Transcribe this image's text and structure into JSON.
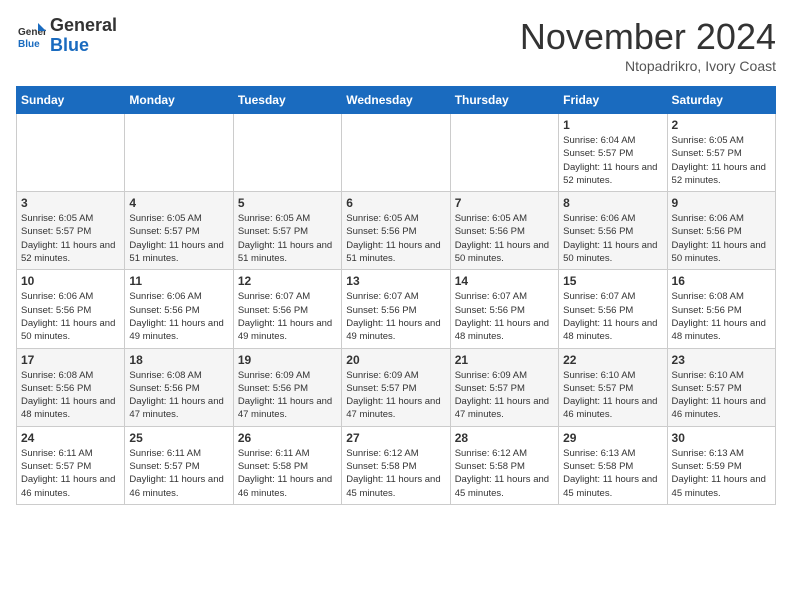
{
  "header": {
    "logo_general": "General",
    "logo_blue": "Blue",
    "month_title": "November 2024",
    "location": "Ntopadrikro, Ivory Coast"
  },
  "days_of_week": [
    "Sunday",
    "Monday",
    "Tuesday",
    "Wednesday",
    "Thursday",
    "Friday",
    "Saturday"
  ],
  "weeks": [
    [
      {
        "day": "",
        "info": ""
      },
      {
        "day": "",
        "info": ""
      },
      {
        "day": "",
        "info": ""
      },
      {
        "day": "",
        "info": ""
      },
      {
        "day": "",
        "info": ""
      },
      {
        "day": "1",
        "info": "Sunrise: 6:04 AM\nSunset: 5:57 PM\nDaylight: 11 hours and 52 minutes."
      },
      {
        "day": "2",
        "info": "Sunrise: 6:05 AM\nSunset: 5:57 PM\nDaylight: 11 hours and 52 minutes."
      }
    ],
    [
      {
        "day": "3",
        "info": "Sunrise: 6:05 AM\nSunset: 5:57 PM\nDaylight: 11 hours and 52 minutes."
      },
      {
        "day": "4",
        "info": "Sunrise: 6:05 AM\nSunset: 5:57 PM\nDaylight: 11 hours and 51 minutes."
      },
      {
        "day": "5",
        "info": "Sunrise: 6:05 AM\nSunset: 5:57 PM\nDaylight: 11 hours and 51 minutes."
      },
      {
        "day": "6",
        "info": "Sunrise: 6:05 AM\nSunset: 5:56 PM\nDaylight: 11 hours and 51 minutes."
      },
      {
        "day": "7",
        "info": "Sunrise: 6:05 AM\nSunset: 5:56 PM\nDaylight: 11 hours and 50 minutes."
      },
      {
        "day": "8",
        "info": "Sunrise: 6:06 AM\nSunset: 5:56 PM\nDaylight: 11 hours and 50 minutes."
      },
      {
        "day": "9",
        "info": "Sunrise: 6:06 AM\nSunset: 5:56 PM\nDaylight: 11 hours and 50 minutes."
      }
    ],
    [
      {
        "day": "10",
        "info": "Sunrise: 6:06 AM\nSunset: 5:56 PM\nDaylight: 11 hours and 50 minutes."
      },
      {
        "day": "11",
        "info": "Sunrise: 6:06 AM\nSunset: 5:56 PM\nDaylight: 11 hours and 49 minutes."
      },
      {
        "day": "12",
        "info": "Sunrise: 6:07 AM\nSunset: 5:56 PM\nDaylight: 11 hours and 49 minutes."
      },
      {
        "day": "13",
        "info": "Sunrise: 6:07 AM\nSunset: 5:56 PM\nDaylight: 11 hours and 49 minutes."
      },
      {
        "day": "14",
        "info": "Sunrise: 6:07 AM\nSunset: 5:56 PM\nDaylight: 11 hours and 48 minutes."
      },
      {
        "day": "15",
        "info": "Sunrise: 6:07 AM\nSunset: 5:56 PM\nDaylight: 11 hours and 48 minutes."
      },
      {
        "day": "16",
        "info": "Sunrise: 6:08 AM\nSunset: 5:56 PM\nDaylight: 11 hours and 48 minutes."
      }
    ],
    [
      {
        "day": "17",
        "info": "Sunrise: 6:08 AM\nSunset: 5:56 PM\nDaylight: 11 hours and 48 minutes."
      },
      {
        "day": "18",
        "info": "Sunrise: 6:08 AM\nSunset: 5:56 PM\nDaylight: 11 hours and 47 minutes."
      },
      {
        "day": "19",
        "info": "Sunrise: 6:09 AM\nSunset: 5:56 PM\nDaylight: 11 hours and 47 minutes."
      },
      {
        "day": "20",
        "info": "Sunrise: 6:09 AM\nSunset: 5:57 PM\nDaylight: 11 hours and 47 minutes."
      },
      {
        "day": "21",
        "info": "Sunrise: 6:09 AM\nSunset: 5:57 PM\nDaylight: 11 hours and 47 minutes."
      },
      {
        "day": "22",
        "info": "Sunrise: 6:10 AM\nSunset: 5:57 PM\nDaylight: 11 hours and 46 minutes."
      },
      {
        "day": "23",
        "info": "Sunrise: 6:10 AM\nSunset: 5:57 PM\nDaylight: 11 hours and 46 minutes."
      }
    ],
    [
      {
        "day": "24",
        "info": "Sunrise: 6:11 AM\nSunset: 5:57 PM\nDaylight: 11 hours and 46 minutes."
      },
      {
        "day": "25",
        "info": "Sunrise: 6:11 AM\nSunset: 5:57 PM\nDaylight: 11 hours and 46 minutes."
      },
      {
        "day": "26",
        "info": "Sunrise: 6:11 AM\nSunset: 5:58 PM\nDaylight: 11 hours and 46 minutes."
      },
      {
        "day": "27",
        "info": "Sunrise: 6:12 AM\nSunset: 5:58 PM\nDaylight: 11 hours and 45 minutes."
      },
      {
        "day": "28",
        "info": "Sunrise: 6:12 AM\nSunset: 5:58 PM\nDaylight: 11 hours and 45 minutes."
      },
      {
        "day": "29",
        "info": "Sunrise: 6:13 AM\nSunset: 5:58 PM\nDaylight: 11 hours and 45 minutes."
      },
      {
        "day": "30",
        "info": "Sunrise: 6:13 AM\nSunset: 5:59 PM\nDaylight: 11 hours and 45 minutes."
      }
    ]
  ]
}
